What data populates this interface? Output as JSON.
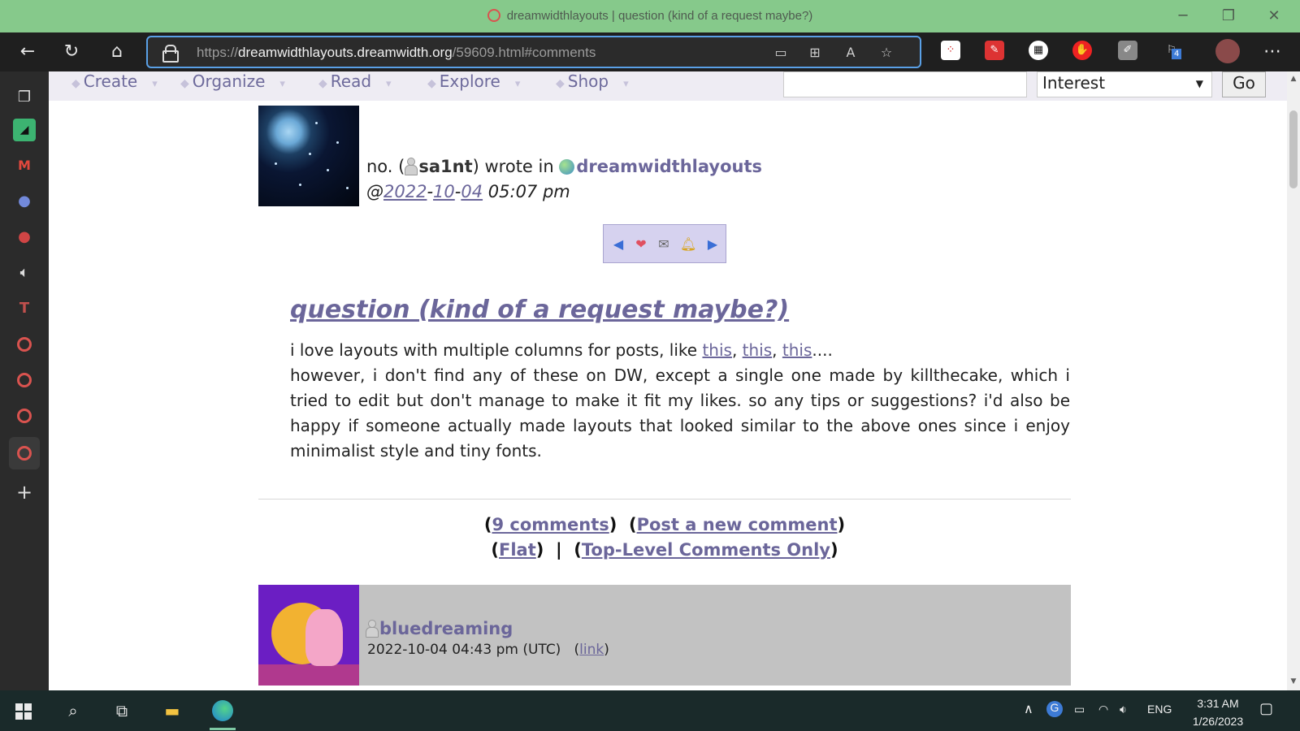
{
  "window": {
    "title": "dreamwidthlayouts | question (kind of a request maybe?)"
  },
  "browser": {
    "url_scheme": "https://",
    "url_host": "dreamwidthlayouts.dreamwidth.org",
    "url_path": "/59609.html#comments",
    "extension_badge": "4"
  },
  "site_nav": {
    "items": [
      {
        "label": "Create"
      },
      {
        "label": "Organize"
      },
      {
        "label": "Read"
      },
      {
        "label": "Explore"
      },
      {
        "label": "Shop"
      }
    ],
    "search_value": "",
    "search_type": "Interest",
    "go_label": "Go"
  },
  "entry": {
    "poster_name": "no.",
    "poster_username": "sa1nt",
    "wrote_in": "wrote in",
    "community": "dreamwidthlayouts",
    "date_prefix": "@",
    "date_year": "2022",
    "date_month": "10",
    "date_day": "04",
    "date_time": "05:07 pm",
    "title": "question (kind of a request maybe?)",
    "body_line1_prefix": "i love layouts with multiple columns for posts, like ",
    "link1": "this",
    "link2": "this",
    "link3": "this",
    "body_line1_suffix": "....",
    "body_rest": "however, i don't find any of these on DW, except a single one made by killthecake, which i tried to edit but don't manage to make it fit my likes. so any tips or suggestions? i'd also be happy if someone actually made layouts that looked similar to the above ones since i enjoy minimalist style and tiny fonts."
  },
  "comment_links": {
    "comments_count": "9 comments",
    "post_new": "Post a new comment",
    "flat": "Flat",
    "top_level": "Top-Level Comments Only"
  },
  "comment": {
    "author": "bluedreaming",
    "date": "2022-10-04 04:43 pm (UTC)",
    "link_label": "link"
  },
  "taskbar": {
    "language": "ENG",
    "time": "3:31 AM",
    "date": "1/26/2023"
  }
}
